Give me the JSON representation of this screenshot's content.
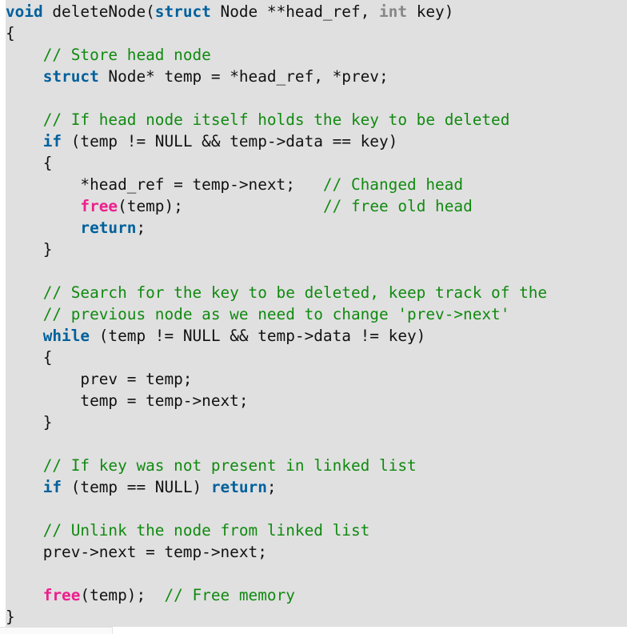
{
  "code": {
    "language": "c",
    "lines": [
      [
        {
          "t": "void",
          "k": "keyword"
        },
        {
          "t": " deleteNode(",
          "k": "plain"
        },
        {
          "t": "struct",
          "k": "keyword"
        },
        {
          "t": " Node **head_ref, ",
          "k": "plain"
        },
        {
          "t": "int",
          "k": "type"
        },
        {
          "t": " key)",
          "k": "plain"
        }
      ],
      [
        {
          "t": "{",
          "k": "plain"
        }
      ],
      [
        {
          "t": "    ",
          "k": "plain"
        },
        {
          "t": "// Store head node",
          "k": "comment"
        }
      ],
      [
        {
          "t": "    ",
          "k": "plain"
        },
        {
          "t": "struct",
          "k": "keyword"
        },
        {
          "t": " Node* temp = *head_ref, *prev;",
          "k": "plain"
        }
      ],
      [],
      [
        {
          "t": "    ",
          "k": "plain"
        },
        {
          "t": "// If head node itself holds the key to be deleted",
          "k": "comment"
        }
      ],
      [
        {
          "t": "    ",
          "k": "plain"
        },
        {
          "t": "if",
          "k": "keyword"
        },
        {
          "t": " (temp != NULL && temp->data == key)",
          "k": "plain"
        }
      ],
      [
        {
          "t": "    {",
          "k": "plain"
        }
      ],
      [
        {
          "t": "        *head_ref = temp->next;   ",
          "k": "plain"
        },
        {
          "t": "// Changed head",
          "k": "comment"
        }
      ],
      [
        {
          "t": "        ",
          "k": "plain"
        },
        {
          "t": "free",
          "k": "builtin"
        },
        {
          "t": "(temp);               ",
          "k": "plain"
        },
        {
          "t": "// free old head",
          "k": "comment"
        }
      ],
      [
        {
          "t": "        ",
          "k": "plain"
        },
        {
          "t": "return",
          "k": "keyword"
        },
        {
          "t": ";",
          "k": "plain"
        }
      ],
      [
        {
          "t": "    }",
          "k": "plain"
        }
      ],
      [],
      [
        {
          "t": "    ",
          "k": "plain"
        },
        {
          "t": "// Search for the key to be deleted, keep track of the",
          "k": "comment"
        }
      ],
      [
        {
          "t": "    ",
          "k": "plain"
        },
        {
          "t": "// previous node as we need to change 'prev->next'",
          "k": "comment"
        }
      ],
      [
        {
          "t": "    ",
          "k": "plain"
        },
        {
          "t": "while",
          "k": "keyword"
        },
        {
          "t": " (temp != NULL && temp->data != key)",
          "k": "plain"
        }
      ],
      [
        {
          "t": "    {",
          "k": "plain"
        }
      ],
      [
        {
          "t": "        prev = temp;",
          "k": "plain"
        }
      ],
      [
        {
          "t": "        temp = temp->next;",
          "k": "plain"
        }
      ],
      [
        {
          "t": "    }",
          "k": "plain"
        }
      ],
      [],
      [
        {
          "t": "    ",
          "k": "plain"
        },
        {
          "t": "// If key was not present in linked list",
          "k": "comment"
        }
      ],
      [
        {
          "t": "    ",
          "k": "plain"
        },
        {
          "t": "if",
          "k": "keyword"
        },
        {
          "t": " (temp == NULL) ",
          "k": "plain"
        },
        {
          "t": "return",
          "k": "keyword"
        },
        {
          "t": ";",
          "k": "plain"
        }
      ],
      [],
      [
        {
          "t": "    ",
          "k": "plain"
        },
        {
          "t": "// Unlink the node from linked list",
          "k": "comment"
        }
      ],
      [
        {
          "t": "    prev->next = temp->next;",
          "k": "plain"
        }
      ],
      [],
      [
        {
          "t": "    ",
          "k": "plain"
        },
        {
          "t": "free",
          "k": "builtin"
        },
        {
          "t": "(temp);  ",
          "k": "plain"
        },
        {
          "t": "// Free memory",
          "k": "comment"
        }
      ],
      [
        {
          "t": "}",
          "k": "plain"
        }
      ]
    ]
  },
  "colors": {
    "panel_background": "#e0e0e0",
    "plain": "#111111",
    "keyword": "#00609c",
    "type": "#878787",
    "builtin": "#ec1f8c",
    "comment": "#108a10"
  }
}
